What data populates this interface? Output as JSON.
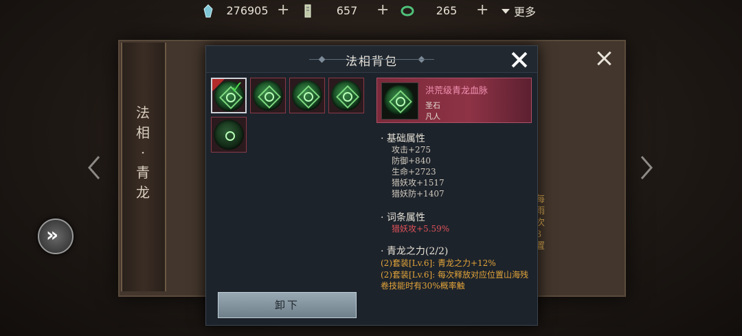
{
  "currencies": [
    {
      "icon": "crystal-icon",
      "value": "276905",
      "plus": "+"
    },
    {
      "icon": "scroll-icon",
      "value": "657",
      "plus": "+"
    },
    {
      "icon": "jade-ring-icon",
      "value": "265",
      "plus": "+"
    }
  ],
  "more_label": "更多",
  "background": {
    "side_title": [
      "法",
      "相",
      "·",
      "青",
      "龙"
    ],
    "right_text": [
      "每",
      "雨",
      "次3",
      "置"
    ]
  },
  "dialog": {
    "title": "法相背包",
    "unequip_label": "卸下",
    "slots": [
      {
        "selected": true,
        "equipped": true
      },
      {
        "selected": false,
        "equipped": false
      },
      {
        "selected": false,
        "equipped": false
      },
      {
        "selected": false,
        "equipped": false
      },
      {
        "selected": false,
        "equipped": false
      }
    ]
  },
  "item": {
    "name": "洪荒级青龙血脉",
    "type": "圣石",
    "rank": "凡人",
    "base_title": "· 基础属性",
    "base_stats": [
      "攻击+275",
      "防御+840",
      "生命+2723",
      "猎妖攻+1517",
      "猎妖防+1407"
    ],
    "affix_title": "· 词条属性",
    "affix_stats": [
      "猎妖攻+5.59%"
    ],
    "set_title": "· 青龙之力(2/2)",
    "set_lines": [
      "(2)套装[Lv.6]: 青龙之力+12%",
      "(2)套装[Lv.6]: 每次释放对应位置山海残卷技能时有30%概率触"
    ]
  },
  "colors": {
    "accent_pink": "#f08fb0",
    "set_gold": "#e3a43a",
    "affix_red": "#e0525a"
  }
}
